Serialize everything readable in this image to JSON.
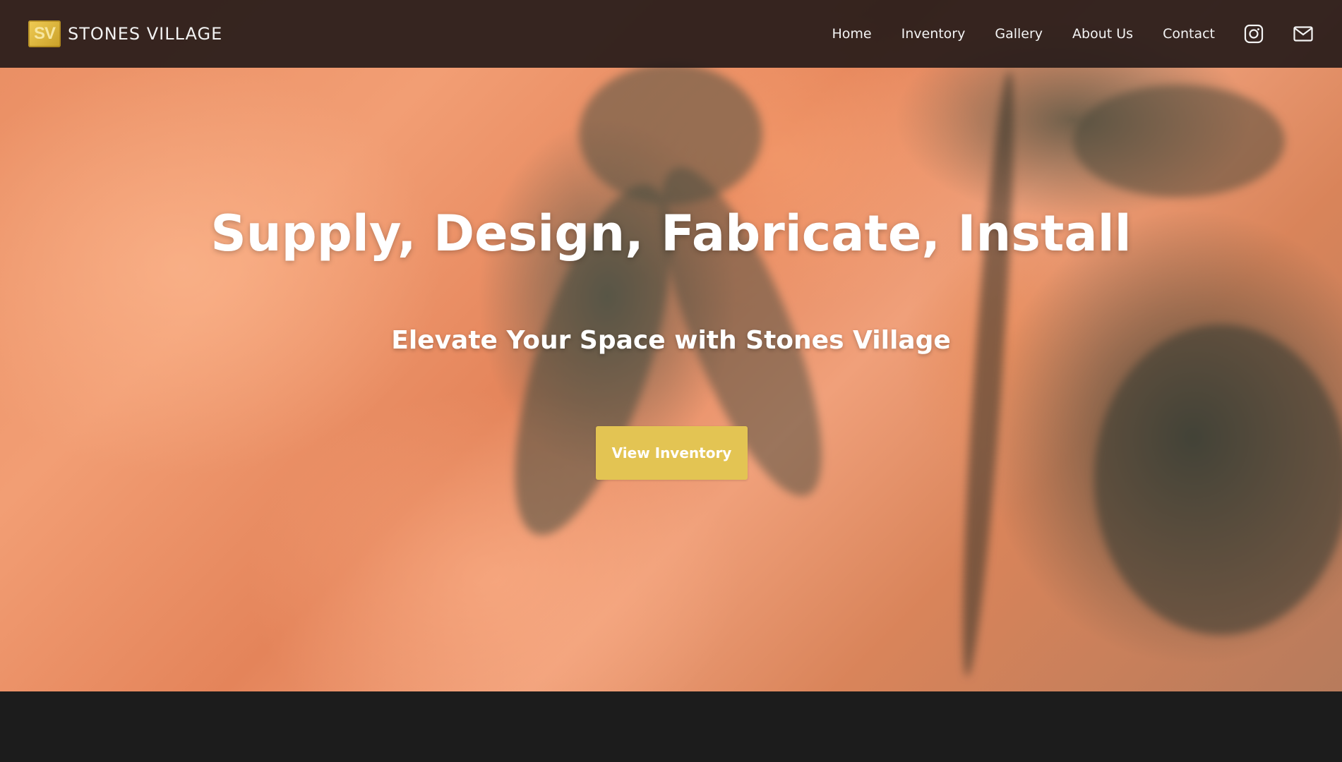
{
  "brand": {
    "logo_text": "SV",
    "name": "STONES VILLAGE"
  },
  "nav": {
    "items": [
      {
        "label": "Home"
      },
      {
        "label": "Inventory"
      },
      {
        "label": "Gallery"
      },
      {
        "label": "About Us"
      },
      {
        "label": "Contact"
      }
    ],
    "icons": [
      "instagram-icon",
      "mail-icon"
    ]
  },
  "hero": {
    "title": "Supply, Design, Fabricate, Install",
    "subtitle": "Elevate Your Space with Stones Village",
    "cta_label": "View Inventory"
  },
  "colors": {
    "navbar_bg": "#281c1a",
    "accent_button": "#e3c453",
    "footer_bg": "#1c1c1c",
    "logo_gold": "#f0cc55"
  }
}
